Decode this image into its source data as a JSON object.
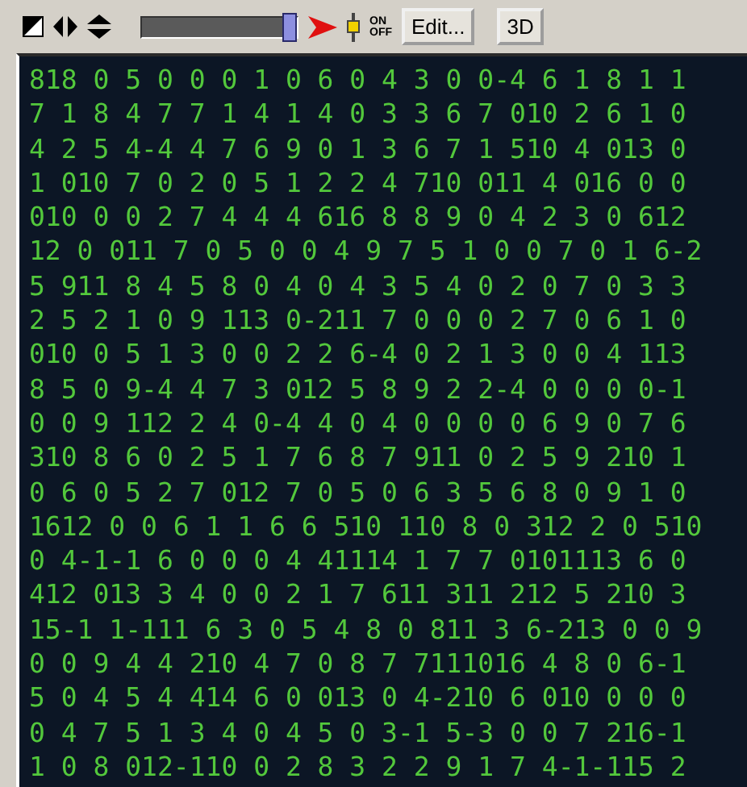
{
  "toolbar": {
    "slider": {
      "level": 1
    },
    "switch": {
      "on_label": "ON",
      "off_label": "OFF"
    },
    "buttons": [
      "Edit...",
      "3D"
    ]
  },
  "grid": {
    "rows": [
      "818 0 5 0 0 0 1 0 6 0 4 3 0 0-4 6 1 8 1 1",
      "7 1 8 4 7 7 1 4 1 4 0 3 3 6 7 010 2 6 1 0",
      "4 2 5 4-4 4 7 6 9 0 1 3 6 7 1 510 4 013 0",
      "1 010 7 0 2 0 5 1 2 2 4 710 011 4 016 0 0",
      "010 0 0 2 7 4 4 4 616 8 8 9 0 4 2 3 0 612",
      "12 0 011 7 0 5 0 0 4 9 7 5 1 0 0 7 0 1 6-2",
      "5 911 8 4 5 8 0 4 0 4 3 5 4 0 2 0 7 0 3 3",
      "2 5 2 1 0 9 113 0-211 7 0 0 0 2 7 0 6 1 0",
      "010 0 5 1 3 0 0 2 2 6-4 0 2 1 3 0 0 4 113",
      "8 5 0 9-4 4 7 3 012 5 8 9 2 2-4 0 0 0 0-1",
      "0 0 9 112 2 4 0-4 4 0 4 0 0 0 0 6 9 0 7 6",
      "310 8 6 0 2 5 1 7 6 8 7 911 0 2 5 9 210 1",
      "0 6 0 5 2 7 012 7 0 5 0 6 3 5 6 8 0 9 1 0",
      "1612 0 0 6 1 1 6 6 510 110 8 0 312 2 0 510",
      "0 4-1-1 6 0 0 0 4 41114 1 7 7 0101113 6 0",
      "412 013 3 4 0 0 2 1 7 611 311 212 5 210 3",
      "15-1 1-111 6 3 0 5 4 8 0 811 3 6-213 0 0 9",
      "0 0 9 4 4 210 4 7 0 8 7 7111016 4 8 0 6-1",
      "5 0 4 5 4 414 6 0 013 0 4-210 6 010 0 0 0",
      "0 4 7 5 1 3 4 0 4 5 0 3-1 5-3 0 0 7 216-1",
      "1 0 8 012-110 0 2 8 3 2 2 9 1 7 4-1-115 2"
    ]
  }
}
